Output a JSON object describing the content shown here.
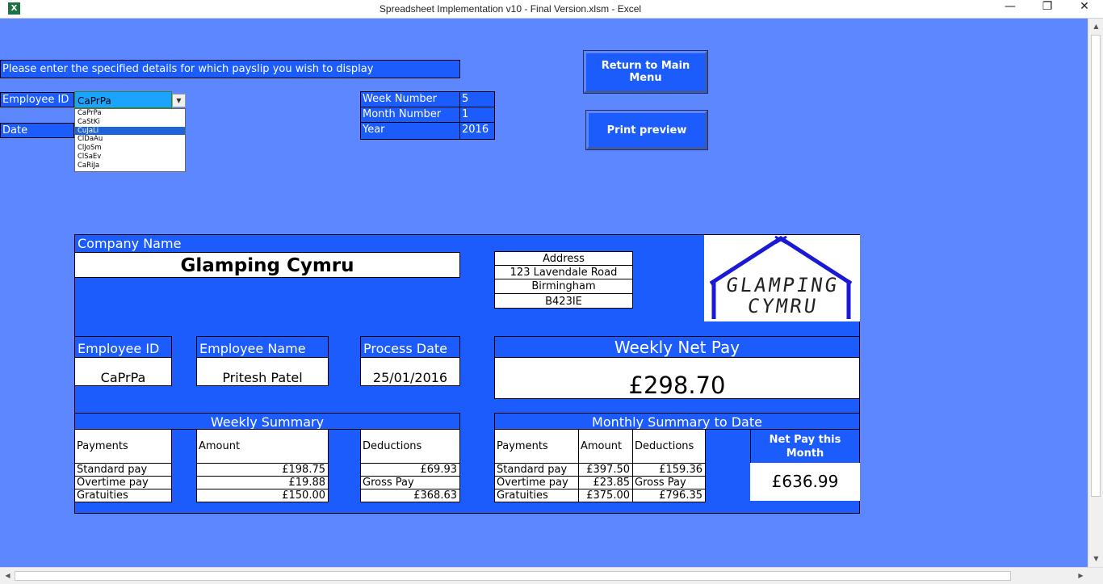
{
  "window": {
    "title": "Spreadsheet Implementation v10 - Final Version.xlsm - Excel",
    "app_icon": "X",
    "minimize_glyph": "—",
    "restore_glyph": "❐",
    "close_glyph": "✕"
  },
  "form": {
    "prompt": "Please enter the specified details for which payslip you wish to display",
    "employee_id_label": "Employee ID",
    "date_label": "Date",
    "employee_id_value": "CaPrPa",
    "dropdown_options": [
      "CaPrPa",
      "CaStKi",
      "CuJaLi",
      "ClDaAu",
      "ClJoSm",
      "ClSaEv",
      "CaRiJa"
    ],
    "dropdown_selected_index": 2,
    "week_number_label": "Week Number",
    "week_number_value": "5",
    "month_number_label": "Month Number",
    "month_number_value": "1",
    "year_label": "Year",
    "year_value": "2016"
  },
  "buttons": {
    "return_main": "Return to Main Menu",
    "print_preview": "Print preview"
  },
  "payslip": {
    "company_name_label": "Company Name",
    "company_name": "Glamping Cymru",
    "address_label": "Address",
    "address_line1": "123 Lavendale Road",
    "address_line2": "Birmingham",
    "address_line3": "B423IE",
    "logo_line1": "GLAMPING",
    "logo_line2": "CYMRU",
    "employee_id_label": "Employee ID",
    "employee_id": "CaPrPa",
    "employee_name_label": "Employee Name",
    "employee_name": "Pritesh Patel",
    "process_date_label": "Process Date",
    "process_date": "25/01/2016",
    "weekly_net_pay_label": "Weekly Net Pay",
    "weekly_net_pay": "£298.70",
    "weekly_summary": {
      "title": "Weekly Summary",
      "payments_header": "Payments",
      "amount_header": "Amount",
      "deductions_header": "Deductions",
      "rows": [
        {
          "label": "Standard pay",
          "amount": "£198.75",
          "deduction": "£69.93"
        },
        {
          "label": "Overtime pay",
          "amount": "£19.88",
          "deduction": "Gross Pay"
        },
        {
          "label": "Gratuities",
          "amount": "£150.00",
          "deduction": "£368.63"
        }
      ]
    },
    "monthly_summary": {
      "title": "Monthly Summary to Date",
      "payments_header": "Payments",
      "amount_header": "Amount",
      "deductions_header": "Deductions",
      "rows": [
        {
          "label": "Standard pay",
          "amount": "£397.50",
          "deduction": "£159.36"
        },
        {
          "label": "Overtime pay",
          "amount": "£23.85",
          "deduction": "Gross Pay"
        },
        {
          "label": "Gratuities",
          "amount": "£375.00",
          "deduction": "£796.35"
        }
      ]
    },
    "net_pay_month_label": "Net Pay this Month",
    "net_pay_month": "£636.99"
  },
  "colors": {
    "sheet_background": "#5c87ff",
    "cell_blue": "#1c5cfc",
    "logo_blue": "#1a1ad6"
  }
}
